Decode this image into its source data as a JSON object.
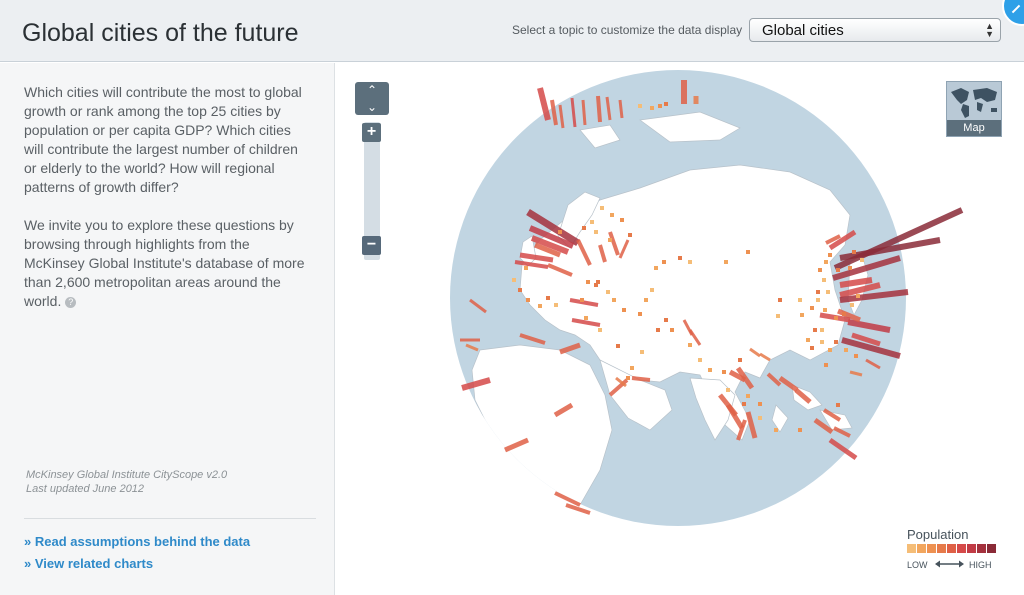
{
  "header": {
    "title": "Global cities of the future",
    "topic_label": "Select a topic to customize the data display",
    "topic_selected": "Global cities"
  },
  "sidebar": {
    "intro_1": "Which cities will contribute the most to global growth or rank among the top 25 cities by population or per capita GDP? Which cities will contribute the largest number of children or elderly to the world? How will regional patterns of growth differ?",
    "intro_2": "We invite you to explore these questions by browsing through highlights from the McKinsey Global Institute's database of more than 2,600 metropolitan areas around the world.",
    "help_glyph": "?",
    "credit_line_1": "McKinsey Global Institute CityScope v2.0",
    "credit_line_2": "Last updated June 2012",
    "link_assumptions": "» Read assumptions behind the data",
    "link_related": "» View related charts"
  },
  "controls": {
    "up_glyph": "⌃",
    "down_glyph": "⌄",
    "zoom_in_glyph": "+",
    "zoom_out_glyph": "−",
    "map_label": "Map"
  },
  "legend": {
    "title": "Population",
    "low": "LOW",
    "high": "HIGH",
    "colors": [
      "#f5bd77",
      "#f2a65e",
      "#ee9151",
      "#e67a4a",
      "#df6046",
      "#d54a49",
      "#c13b45",
      "#a4313d",
      "#8a2a37"
    ]
  },
  "colors": {
    "ocean": "#c1d5e2",
    "land": "#ffffff",
    "accent": "#2f8ac9",
    "bar_low": "#f2a65e",
    "bar_high": "#8a2a37"
  },
  "icons": {
    "corner": "expand-icon",
    "help": "help-icon",
    "map": "world-map-icon"
  }
}
